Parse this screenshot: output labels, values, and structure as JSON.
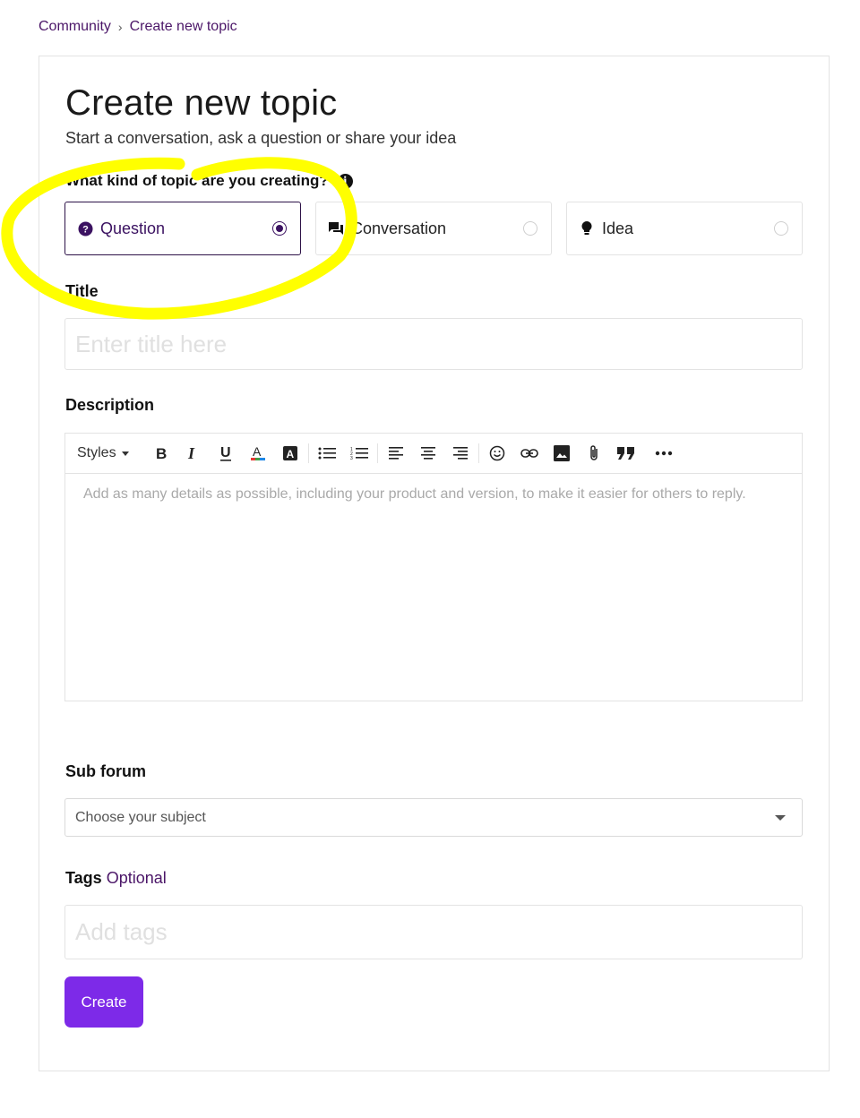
{
  "breadcrumb": {
    "root": "Community",
    "separator": "›",
    "current": "Create new topic"
  },
  "page": {
    "title": "Create new topic",
    "subtitle": "Start a conversation, ask a question or share your idea"
  },
  "topic_kind": {
    "label": "What kind of topic are you creating?",
    "info_icon": "info-icon",
    "options": [
      {
        "label": "Question",
        "icon": "question-circle-icon",
        "selected": true
      },
      {
        "label": "Conversation",
        "icon": "chat-bubbles-icon",
        "selected": false
      },
      {
        "label": "Idea",
        "icon": "lightbulb-icon",
        "selected": false
      }
    ]
  },
  "title_field": {
    "label": "Title",
    "placeholder": "Enter title here"
  },
  "description": {
    "label": "Description",
    "styles_label": "Styles",
    "toolbar": [
      "bold-icon",
      "italic-icon",
      "underline-icon",
      "text-color-icon",
      "highlight-icon",
      "bulleted-list-icon",
      "numbered-list-icon",
      "align-left-icon",
      "align-center-icon",
      "align-right-icon",
      "emoji-icon",
      "link-icon",
      "image-icon",
      "attachment-icon",
      "quote-icon",
      "more-icon"
    ],
    "placeholder": "Add as many details as possible, including your product and version, to make it easier for others to reply."
  },
  "sub_forum": {
    "label": "Sub forum",
    "value": "Choose your subject"
  },
  "tags": {
    "label": "Tags",
    "optional": "Optional",
    "placeholder": "Add tags"
  },
  "create_label": "Create",
  "colors": {
    "brand": "#4b1668",
    "button": "#7d2ae8",
    "annotation": "#ffff00"
  }
}
